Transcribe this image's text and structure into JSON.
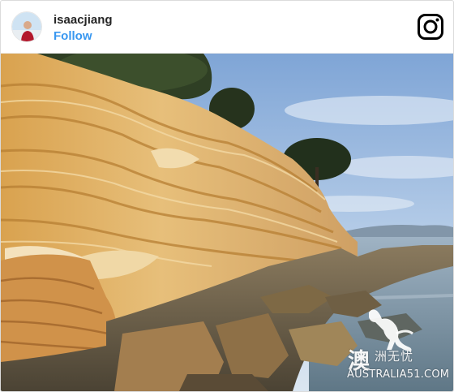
{
  "header": {
    "username": "isaacjiang",
    "follow_label": "Follow"
  },
  "icons": {
    "brand_icon": "instagram-icon",
    "avatar": "profile-avatar"
  },
  "colors": {
    "follow": "#3897f0",
    "username": "#262626",
    "border": "#dbdbdb"
  },
  "watermark": {
    "chinese_large": "澳",
    "chinese_small": "洲无忧",
    "site": "AUSTRALIA51.COM"
  }
}
